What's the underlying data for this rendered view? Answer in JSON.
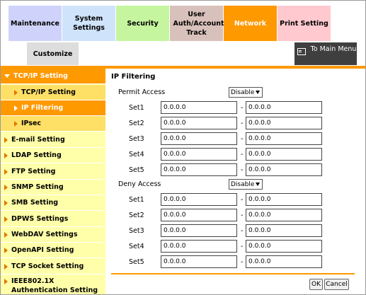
{
  "tabs": {
    "maintenance": "Maintenance",
    "system_settings": "System Settings",
    "security": "Security",
    "user_auth": "User Auth/Account Track",
    "network": "Network",
    "print_setting": "Print Setting",
    "customize": "Customize"
  },
  "to_main_menu": "To Main Menu",
  "sidebar": [
    {
      "label": "TCP/IP Setting",
      "state": "expanded"
    },
    {
      "label": "TCP/IP Setting",
      "state": "child"
    },
    {
      "label": "IP Filtering",
      "state": "selected-child"
    },
    {
      "label": "IPsec",
      "state": "child"
    },
    {
      "label": "E-mail Setting",
      "state": "collapsed"
    },
    {
      "label": "LDAP Setting",
      "state": "collapsed"
    },
    {
      "label": "FTP Setting",
      "state": "collapsed"
    },
    {
      "label": "SNMP Setting",
      "state": "collapsed"
    },
    {
      "label": "SMB Setting",
      "state": "collapsed"
    },
    {
      "label": "DPWS Settings",
      "state": "collapsed"
    },
    {
      "label": "WebDAV Settings",
      "state": "collapsed"
    },
    {
      "label": "OpenAPI Setting",
      "state": "collapsed"
    },
    {
      "label": "TCP Socket Setting",
      "state": "collapsed"
    },
    {
      "label": "IEEE802.1X Authentication Setting",
      "state": "collapsed"
    }
  ],
  "content": {
    "title": "IP Filtering",
    "permit": {
      "label": "Permit Access",
      "value": "Disable",
      "sets": [
        {
          "label": "Set1",
          "from": "0.0.0.0",
          "to": "0.0.0.0"
        },
        {
          "label": "Set2",
          "from": "0.0.0.0",
          "to": "0.0.0.0"
        },
        {
          "label": "Set3",
          "from": "0.0.0.0",
          "to": "0.0.0.0"
        },
        {
          "label": "Set4",
          "from": "0.0.0.0",
          "to": "0.0.0.0"
        },
        {
          "label": "Set5",
          "from": "0.0.0.0",
          "to": "0.0.0.0"
        }
      ]
    },
    "deny": {
      "label": "Deny Access",
      "value": "Disable",
      "sets": [
        {
          "label": "Set1",
          "from": "0.0.0.0",
          "to": "0.0.0.0"
        },
        {
          "label": "Set2",
          "from": "0.0.0.0",
          "to": "0.0.0.0"
        },
        {
          "label": "Set3",
          "from": "0.0.0.0",
          "to": "0.0.0.0"
        },
        {
          "label": "Set4",
          "from": "0.0.0.0",
          "to": "0.0.0.0"
        },
        {
          "label": "Set5",
          "from": "0.0.0.0",
          "to": "0.0.0.0"
        }
      ]
    },
    "range_separator": "-"
  },
  "buttons": {
    "ok": "OK",
    "cancel": "Cancel"
  },
  "colors": {
    "accent": "#ff9900",
    "sidebar_bg": "#ffffaa",
    "sidebar_child_bg": "#ffe066"
  }
}
